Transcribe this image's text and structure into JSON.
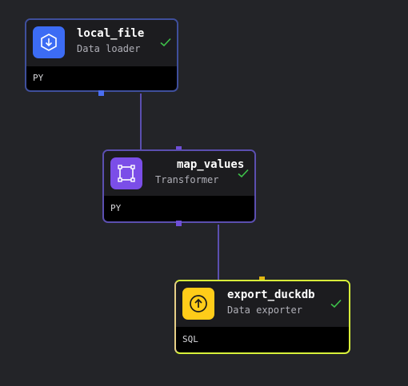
{
  "canvas": {
    "background": "#232428",
    "edge_color": "#5b4fb0"
  },
  "blocks": [
    {
      "name": "local_file",
      "type": "Data loader",
      "language": "PY",
      "status": "success",
      "icon": "download-arrow-icon",
      "icon_color": "#3c6cf4",
      "border_color": "#3f4f9c",
      "port_color": "#4a6ef0"
    },
    {
      "name": "map_values",
      "type": "Transformer",
      "language": "PY",
      "status": "success",
      "icon": "square-frame-icon",
      "icon_color": "#7b4ee8",
      "border_color": "#5b4fb0",
      "port_color": "#6f4fd8"
    },
    {
      "name": "export_duckdb",
      "type": "Data exporter",
      "language": "SQL",
      "status": "success",
      "icon": "upload-arrow-icon",
      "icon_color": "#ffcc19",
      "border_color": "#d8f23a",
      "port_color": "#e2b712"
    }
  ],
  "status_color": "#3ec24a"
}
